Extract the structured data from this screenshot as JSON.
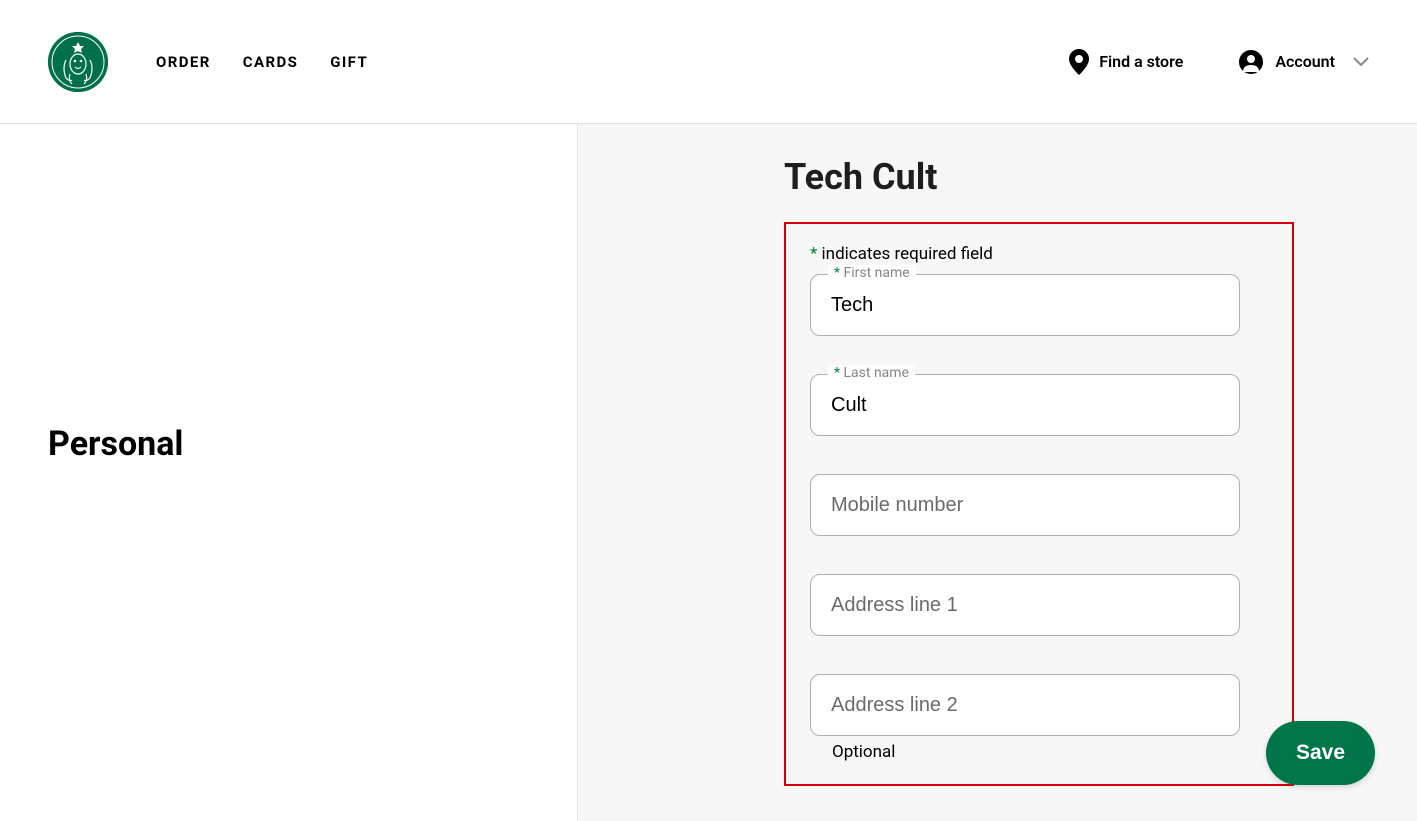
{
  "header": {
    "nav": {
      "order": "ORDER",
      "cards": "CARDS",
      "gift": "GIFT"
    },
    "find_store": "Find a store",
    "account": "Account"
  },
  "sidebar": {
    "title": "Personal"
  },
  "page": {
    "title": "Tech Cult",
    "required_note_asterisk": "*",
    "required_note_text": " indicates required field",
    "fields": {
      "first_name": {
        "label_asterisk": "*",
        "label_text": " First name",
        "value": "Tech"
      },
      "last_name": {
        "label_asterisk": "*",
        "label_text": " Last name",
        "value": "Cult"
      },
      "mobile": {
        "placeholder": "Mobile number",
        "value": ""
      },
      "address1": {
        "placeholder": "Address line 1",
        "value": ""
      },
      "address2": {
        "placeholder": "Address line 2",
        "value": "",
        "optional": "Optional"
      }
    },
    "save": "Save"
  }
}
